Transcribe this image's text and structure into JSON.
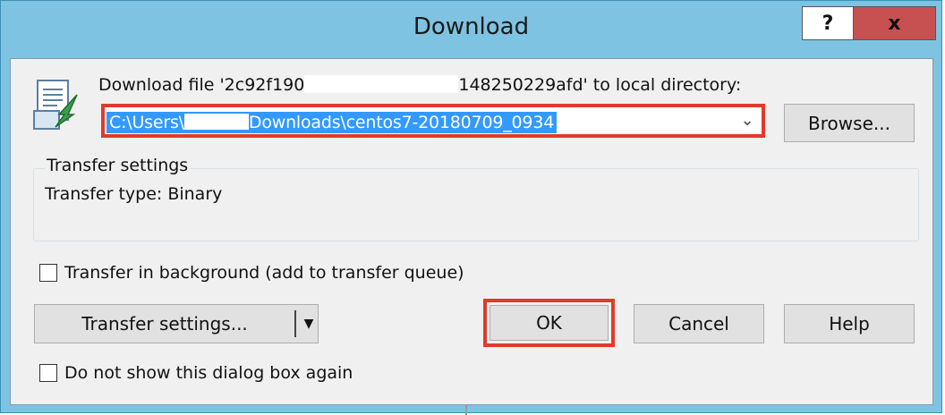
{
  "window": {
    "title": "Download",
    "help_button_label": "?",
    "close_button_label": "x"
  },
  "download": {
    "label_prefix": "Download file '2c92f190",
    "label_suffix": "148250229afd' to local directory:",
    "path_prefix": "C:\\Users\\",
    "path_suffix": "Downloads\\centos7-20180709_0934",
    "browse_label": "Browse..."
  },
  "transfer_group": {
    "title": "Transfer settings",
    "type_line": "Transfer type: Binary"
  },
  "options": {
    "background_label": "Transfer in background (add to transfer queue)",
    "dont_show_label": "Do not show this dialog box again"
  },
  "buttons": {
    "transfer_settings": "Transfer settings...",
    "ok": "OK",
    "cancel": "Cancel",
    "help": "Help"
  },
  "colors": {
    "titlebar": "#7ec3e2",
    "client": "#f0f0f0",
    "highlight_box": "#e03a2b",
    "selection": "#3399ff",
    "close_button": "#c75050"
  },
  "icons": {
    "dialog_icon": "download-document-icon",
    "combo_arrow": "chevron-down-icon",
    "split_arrow": "triangle-down-icon"
  }
}
